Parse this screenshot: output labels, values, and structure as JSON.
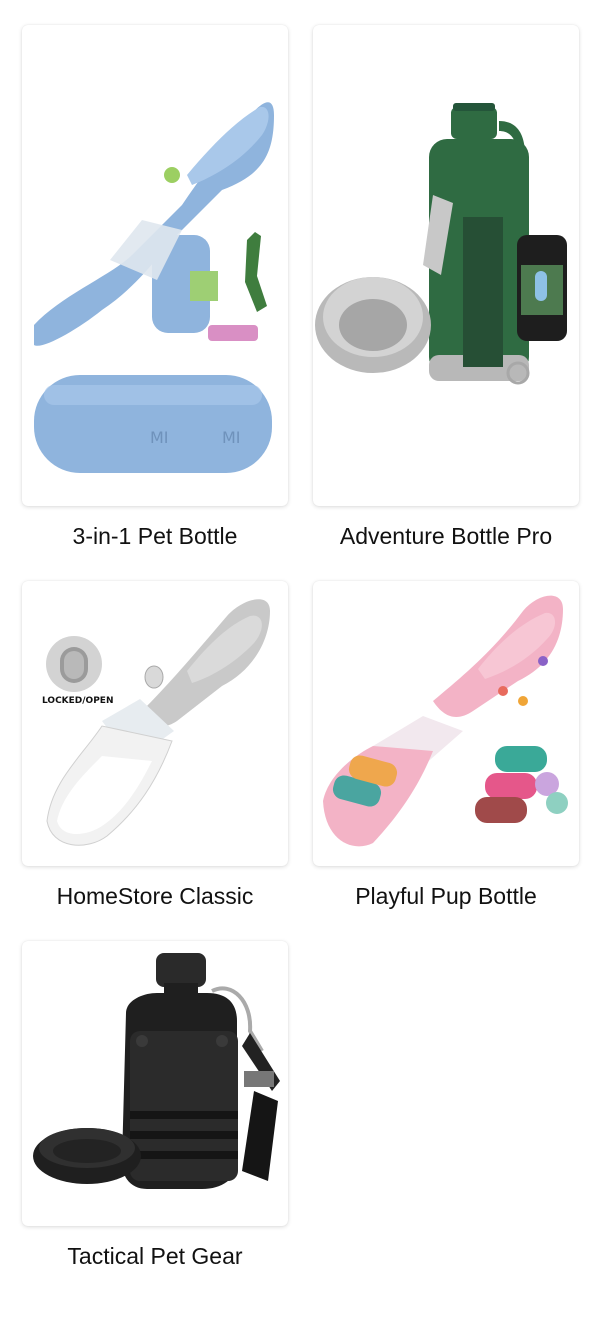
{
  "products": [
    {
      "title": "3-in-1 Pet Bottle",
      "image_icon": "blue-pet-water-bottle-with-bag-dispenser-and-scoop"
    },
    {
      "title": "Adventure Bottle Pro",
      "image_icon": "green-insulated-bottle-with-steel-bowl"
    },
    {
      "title": "HomeStore Classic",
      "image_icon": "gray-white-pet-water-bottle",
      "lock_label": "LOCKED/OPEN"
    },
    {
      "title": "Playful Pup Bottle",
      "image_icon": "pink-paw-print-bottle-with-waste-bags"
    },
    {
      "title": "Tactical Pet Gear",
      "image_icon": "black-tactical-canteen-with-bowl"
    }
  ],
  "colors": {
    "blue_bottle": "#8fb4dd",
    "green_bottle": "#2f6b42",
    "gray_bottle": "#c9c9c9",
    "pink_bottle": "#f3b3c6",
    "black_bottle": "#1f1f1f"
  }
}
